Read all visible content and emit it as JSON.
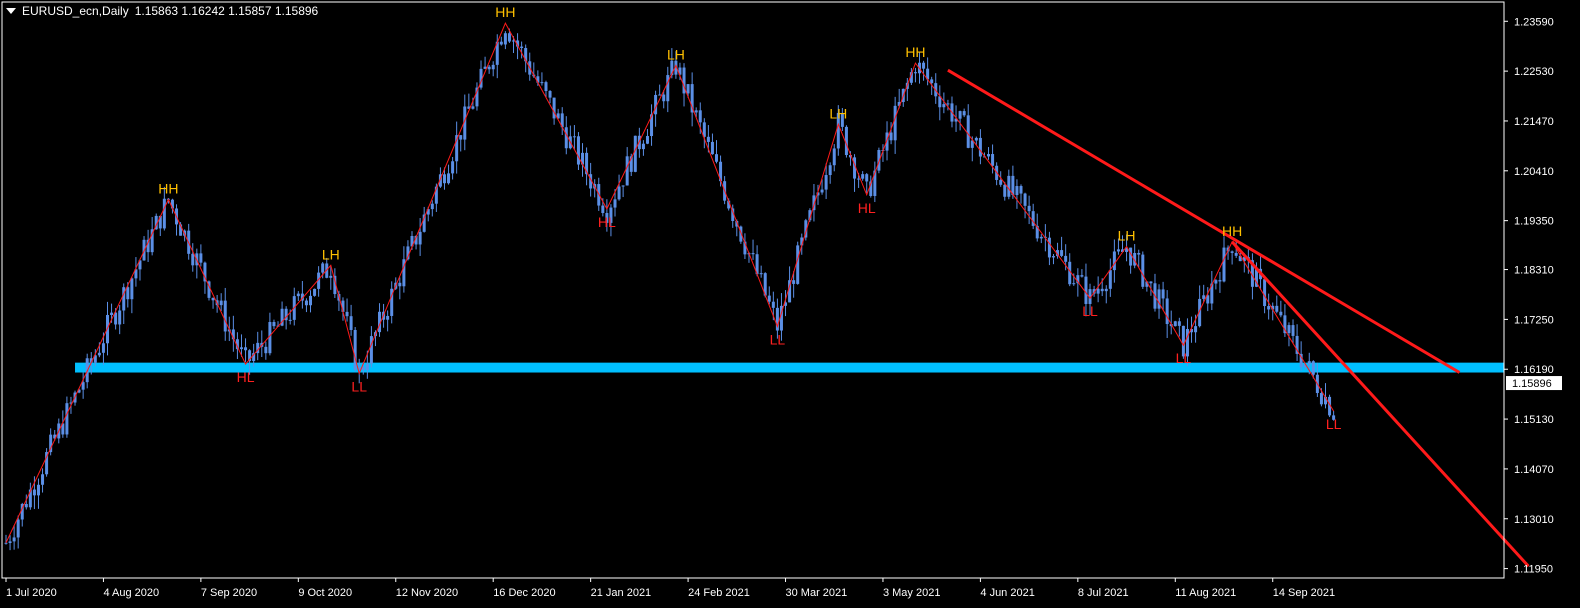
{
  "header": {
    "symbol": "EURUSD_ecn,Daily",
    "ohlc": "1.15863 1.16242 1.15857 1.15896"
  },
  "chart_data": {
    "type": "candlestick",
    "title": "EURUSD_ecn,Daily",
    "ylim": [
      1.1175,
      1.24
    ],
    "y_ticks": [
      "1.23590",
      "1.22530",
      "1.21470",
      "1.20410",
      "1.19350",
      "1.18310",
      "1.17250",
      "1.16190",
      "1.15130",
      "1.14070",
      "1.13010",
      "1.11950"
    ],
    "x_ticks": [
      "1 Jul 2020",
      "4 Aug 2020",
      "7 Sep 2020",
      "9 Oct 2020",
      "12 Nov 2020",
      "16 Dec 2020",
      "21 Jan 2021",
      "24 Feb 2021",
      "30 Mar 2021",
      "3 May 2021",
      "4 Jun 2021",
      "8 Jul 2021",
      "11 Aug 2021",
      "14 Sep 2021"
    ],
    "x_tick_positions": [
      0,
      24,
      48,
      72,
      96,
      120,
      144,
      168,
      192,
      216,
      240,
      264,
      288,
      312
    ],
    "current_price": "1.15896",
    "candle_color": "#5b8fe6",
    "background": "#000000",
    "zigzag_points": [
      {
        "bar": 0,
        "price": 1.125
      },
      {
        "bar": 40,
        "price": 1.198,
        "label": "HH"
      },
      {
        "bar": 59,
        "price": 1.163,
        "label": "HL"
      },
      {
        "bar": 80,
        "price": 1.184,
        "label": "LH"
      },
      {
        "bar": 87,
        "price": 1.161,
        "label": "LL"
      },
      {
        "bar": 123,
        "price": 1.2355,
        "label": "HH"
      },
      {
        "bar": 148,
        "price": 1.196,
        "label": "HL"
      },
      {
        "bar": 165,
        "price": 1.2265,
        "label": "LH"
      },
      {
        "bar": 190,
        "price": 1.171,
        "label": "LL"
      },
      {
        "bar": 205,
        "price": 1.214,
        "label": "LH"
      },
      {
        "bar": 212,
        "price": 1.199,
        "label": "HL"
      },
      {
        "bar": 224,
        "price": 1.227,
        "label": "HH"
      },
      {
        "bar": 267,
        "price": 1.177,
        "label": "LL"
      },
      {
        "bar": 276,
        "price": 1.188,
        "label": "LH"
      },
      {
        "bar": 290,
        "price": 1.167,
        "label": "LL"
      },
      {
        "bar": 302,
        "price": 1.189,
        "label": "HH"
      },
      {
        "bar": 327,
        "price": 1.153,
        "label": "LL"
      }
    ],
    "support_zone": {
      "from_bar": 17,
      "low": 1.1612,
      "high": 1.1633,
      "color": "#00bfff"
    },
    "trendlines": [
      {
        "bar1": 232,
        "price1": 1.2255,
        "bar2": 358,
        "price2": 1.1612,
        "color": "#ff1a1a"
      },
      {
        "bar1": 302,
        "price1": 1.189,
        "bar2": 375,
        "price2": 1.12,
        "color": "#ff1a1a"
      }
    ],
    "label_colors": {
      "high": "#ffc000",
      "low": "#ff2020"
    }
  }
}
